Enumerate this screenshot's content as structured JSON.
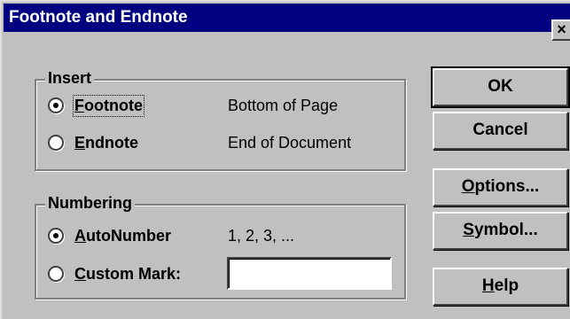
{
  "window": {
    "title": "Footnote and Endnote",
    "close_glyph": "×"
  },
  "insert_group": {
    "title": "Insert",
    "options": [
      {
        "label_prefix": "",
        "label_mnemonic": "F",
        "label_rest": "ootnote",
        "description": "Bottom of Page",
        "checked": true
      },
      {
        "label_prefix": "",
        "label_mnemonic": "E",
        "label_rest": "ndnote",
        "description": "End of Document",
        "checked": false
      }
    ]
  },
  "numbering_group": {
    "title": "Numbering",
    "options": [
      {
        "label_prefix": "",
        "label_mnemonic": "A",
        "label_rest": "utoNumber",
        "description": "1, 2, 3, ...",
        "checked": true
      },
      {
        "label_prefix": "",
        "label_mnemonic": "C",
        "label_rest": "ustom Mark:",
        "checked": false
      }
    ],
    "custom_mark_value": ""
  },
  "buttons": {
    "ok": {
      "mnemonic": "",
      "rest": "OK"
    },
    "cancel": {
      "mnemonic": "",
      "rest": "Cancel"
    },
    "options": {
      "mnemonic": "O",
      "rest": "ptions..."
    },
    "symbol": {
      "mnemonic": "S",
      "rest": "ymbol..."
    },
    "help": {
      "mnemonic": "H",
      "rest": "elp"
    }
  },
  "colors": {
    "titlebar": "#000080",
    "dialog_face": "#c0c0c0"
  }
}
